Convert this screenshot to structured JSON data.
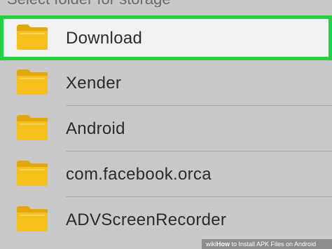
{
  "folders": [
    {
      "label": "Download",
      "icon": "folder-icon",
      "selected": true
    },
    {
      "label": "Xender",
      "icon": "folder-icon"
    },
    {
      "label": "Android",
      "icon": "folder-icon"
    },
    {
      "label": "com.facebook.orca",
      "icon": "folder-icon"
    },
    {
      "label": "ADVScreenRecorder",
      "icon": "folder-icon"
    }
  ],
  "top_partial_text": "Select folder for storage",
  "footer": {
    "prefix": "wiki",
    "bold": "How",
    "text": " to Install APK Files on Android"
  },
  "colors": {
    "highlight": "#22d33f",
    "folder_front": "#f6c21a",
    "folder_back": "#e2a60f"
  }
}
